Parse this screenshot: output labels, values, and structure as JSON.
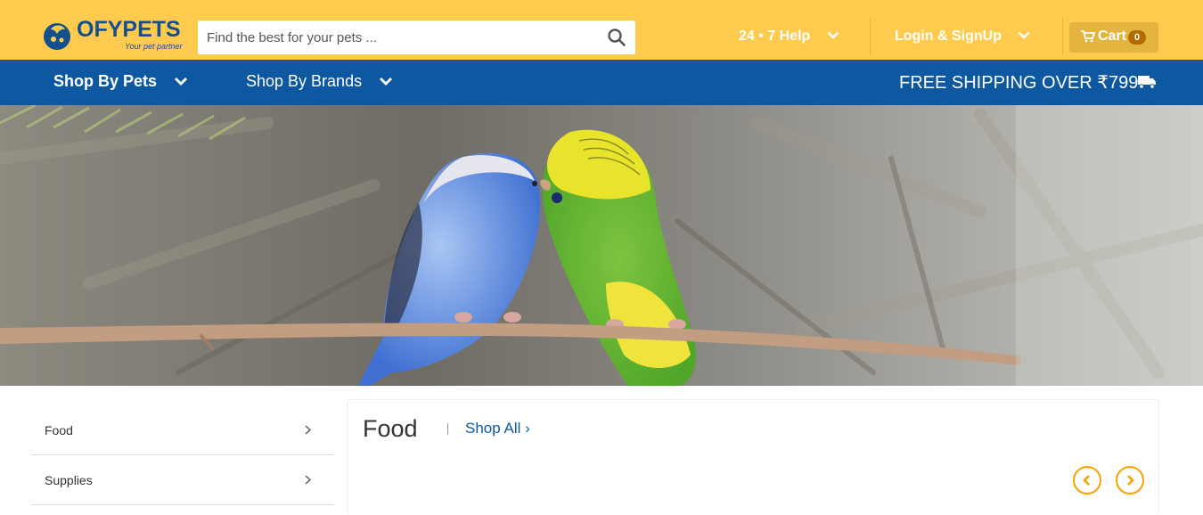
{
  "brand": {
    "name": "OFYPETS",
    "tagline": "Your pet partner"
  },
  "search": {
    "placeholder": "Find the best for your pets ..."
  },
  "topnav": {
    "help": "24 • 7 Help",
    "login": "Login & SignUp"
  },
  "cart": {
    "label": "Cart",
    "count": "0"
  },
  "nav": {
    "shop_by_pets": "Shop By Pets",
    "shop_by_brands": "Shop By Brands",
    "shipping": "FREE SHIPPING OVER ₹799"
  },
  "sidebar": {
    "items": [
      {
        "label": "Food"
      },
      {
        "label": "Supplies"
      }
    ]
  },
  "section": {
    "title": "Food",
    "shop_all": "Shop All ›"
  },
  "colors": {
    "topbar": "#fecb4f",
    "nav": "#0d58a0",
    "accent": "#f5a300"
  },
  "icons": {
    "search": "search-icon",
    "cart": "cart-icon",
    "truck": "truck-icon",
    "chevron": "chevron-down-icon"
  }
}
